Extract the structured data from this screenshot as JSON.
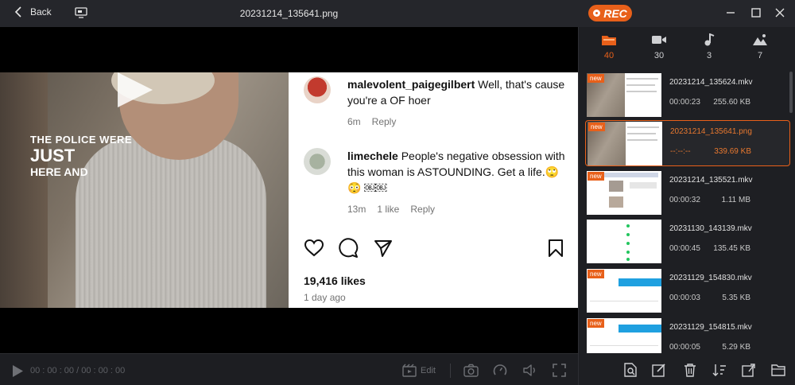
{
  "titlebar": {
    "back_label": "Back",
    "title": "20231214_135641.png",
    "rec_label": "REC",
    "accent": "#e8601a"
  },
  "preview": {
    "caption": {
      "line1": "THE POLICE WERE",
      "line2": "JUST",
      "line3": "HERE AND"
    },
    "comments": [
      {
        "user": "malevolent_paigegilbert",
        "text": "Well, that's cause you're a OF hoer",
        "age": "6m",
        "likes": "",
        "reply": "Reply"
      },
      {
        "user": "limechele",
        "text": "People's negative obsession with this woman is ASTOUNDING. Get a life.🙄 😳 ￼￼",
        "age": "13m",
        "likes": "1 like",
        "reply": "Reply"
      }
    ],
    "likes": "19,416 likes",
    "ago": "1 day ago"
  },
  "controls": {
    "time": "00 : 00 : 00 / 00 : 00 : 00",
    "edit_label": "Edit"
  },
  "panel": {
    "tabs": [
      {
        "icon": "folder-icon",
        "count": "40",
        "active": true
      },
      {
        "icon": "video-icon",
        "count": "30",
        "active": false
      },
      {
        "icon": "music-icon",
        "count": "3",
        "active": false
      },
      {
        "icon": "image-icon",
        "count": "7",
        "active": false
      }
    ],
    "files": [
      {
        "name": "20231214_135624.mkv",
        "duration": "00:00:23",
        "size": "255.60 KB",
        "badge": "new",
        "selected": false
      },
      {
        "name": "20231214_135641.png",
        "duration": "--:--:--",
        "size": "339.69 KB",
        "badge": "new",
        "selected": true
      },
      {
        "name": "20231214_135521.mkv",
        "duration": "00:00:32",
        "size": "1.11 MB",
        "badge": "new",
        "selected": false
      },
      {
        "name": "20231130_143139.mkv",
        "duration": "00:00:45",
        "size": "135.45 KB",
        "badge": "",
        "selected": false
      },
      {
        "name": "20231129_154830.mkv",
        "duration": "00:00:03",
        "size": "5.35 KB",
        "badge": "new",
        "selected": false
      },
      {
        "name": "20231129_154815.mkv",
        "duration": "00:00:05",
        "size": "5.29 KB",
        "badge": "new",
        "selected": false
      }
    ]
  }
}
